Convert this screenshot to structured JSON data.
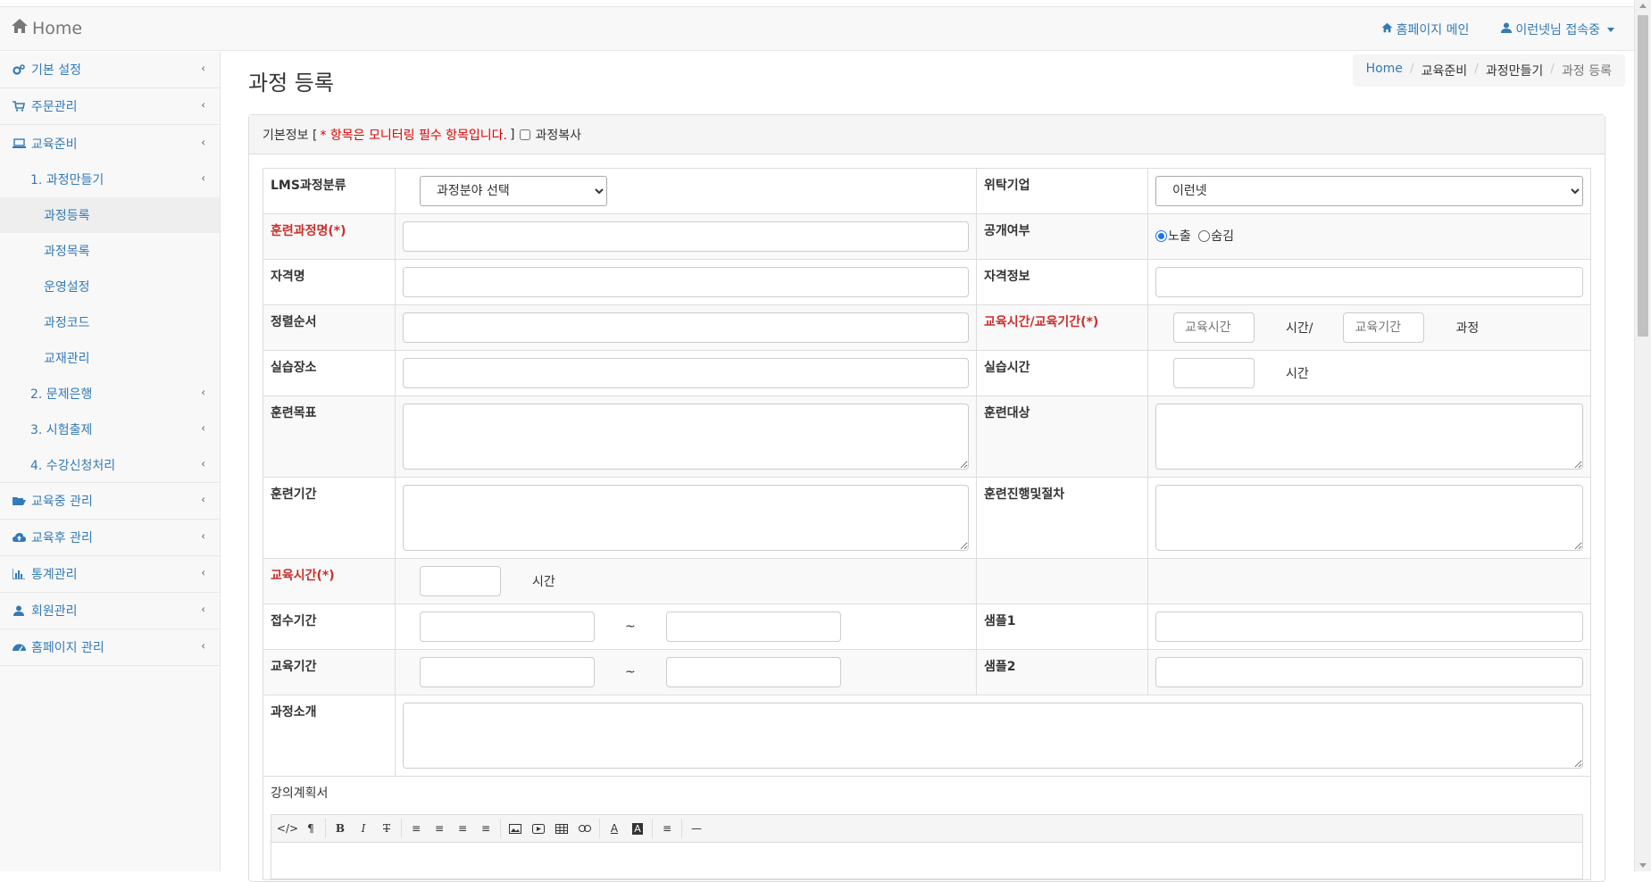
{
  "topbar": {
    "brand": "Home",
    "homepage_link": "홈페이지 메인",
    "user_menu": "이런넷님 접속중"
  },
  "sidebar": {
    "items": [
      {
        "label": "기본 설정",
        "icon": "gears-icon"
      },
      {
        "label": "주문관리",
        "icon": "cart-icon"
      },
      {
        "label": "교육준비",
        "icon": "laptop-icon"
      }
    ],
    "sub": {
      "course_make": "1. 과정만들기",
      "course_register": "과정등록",
      "course_list": "과정목록",
      "operation": "운영설정",
      "course_code": "과정코드",
      "textbook": "교재관리",
      "question_bank": "2. 문제은행",
      "exam": "3. 시험출제",
      "enroll": "4. 수강신청처리"
    },
    "items2": [
      {
        "label": "교육중 관리",
        "icon": "folder-open-icon"
      },
      {
        "label": "교육후 관리",
        "icon": "cloud-upload-icon"
      },
      {
        "label": "통계관리",
        "icon": "bar-chart-icon"
      },
      {
        "label": "회원관리",
        "icon": "user-icon"
      },
      {
        "label": "홈페이지 관리",
        "icon": "dashboard-icon"
      }
    ]
  },
  "main": {
    "title": "과정 등록",
    "breadcrumb": [
      "Home",
      "교육준비",
      "과정만들기",
      "과정 등록"
    ]
  },
  "panel": {
    "head_label": "기본정보 [",
    "head_required": "* 항목은 모니터링 필수 항목입니다.",
    "head_close": "]",
    "copy_label": "과정복사"
  },
  "form": {
    "lms_category": "LMS과정분류",
    "lms_category_select": "과정분야 선택",
    "consign_company": "위탁기업",
    "consign_company_select": "이런넷",
    "course_name": "훈련과정명(*)",
    "public": "공개여부",
    "public_show": "노출",
    "public_hide": "숨김",
    "license_name": "자격명",
    "license_info": "자격정보",
    "sort_order": "정렬순서",
    "edu_time_period": "교육시간/교육기간(*)",
    "edu_time_placeholder": "교육시간",
    "time_unit_slash": "시간/",
    "edu_period_placeholder": "교육기간",
    "course_unit": "과정",
    "practice_place": "실습장소",
    "practice_time": "실습시간",
    "time_unit": "시간",
    "training_goal": "훈련목표",
    "training_target": "훈련대상",
    "training_period": "훈련기간",
    "training_procedure": "훈련진행및절차",
    "edu_time": "교육시간(*)",
    "reception_period": "접수기간",
    "tilde": "~",
    "sample1": "샘플1",
    "edu_period": "교육기간",
    "sample2": "샘플2",
    "course_intro": "과정소개",
    "lecture_plan": "강의계획서"
  },
  "editor": {
    "tools": [
      "code-icon",
      "paragraph-icon",
      "bold-icon",
      "italic-icon",
      "strikethrough-icon",
      "bullet-list-icon",
      "numbered-list-icon",
      "outdent-icon",
      "indent-icon",
      "image-icon",
      "video-icon",
      "table-icon",
      "link-icon",
      "font-color-icon",
      "bg-color-icon",
      "align-icon",
      "horizontal-rule-icon"
    ]
  },
  "colors": {
    "accent": "#337ab7",
    "required": "#c9302c"
  }
}
